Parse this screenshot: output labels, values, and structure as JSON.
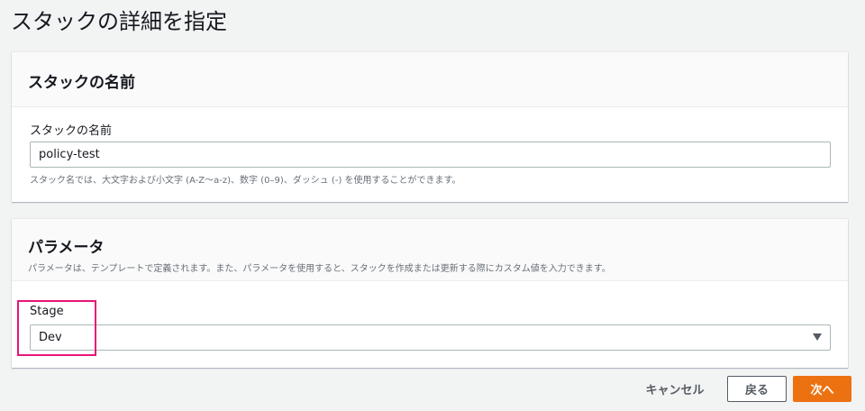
{
  "page_title": "スタックの詳細を指定",
  "stack_name_section": {
    "heading": "スタックの名前",
    "field_label": "スタックの名前",
    "value": "policy-test",
    "help": "スタック名では、大文字および小文字 (A-Z～a-z)、数字 (0–9)、ダッシュ (-) を使用することができます。"
  },
  "parameters_section": {
    "heading": "パラメータ",
    "description": "パラメータは、テンプレートで定義されます。また、パラメータを使用すると、スタックを作成または更新する際にカスタム値を入力できます。",
    "stage_label": "Stage",
    "stage_value": "Dev"
  },
  "footer": {
    "cancel": "キャンセル",
    "back": "戻る",
    "next": "次へ"
  },
  "colors": {
    "primary": "#ec7211",
    "highlight": "#e8157a"
  }
}
